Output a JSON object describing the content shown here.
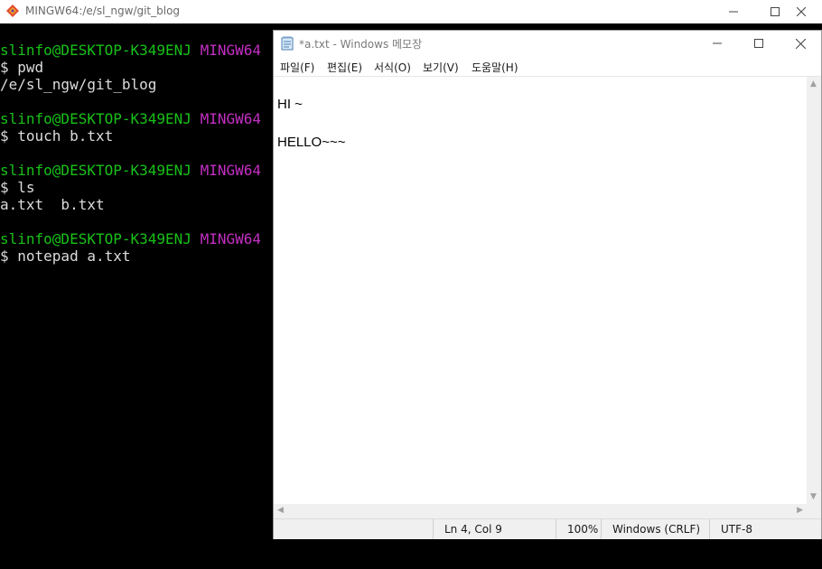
{
  "terminal": {
    "title": "MINGW64:/e/sl_ngw/git_blog",
    "lines": [
      {
        "user": "slinfo@DESKTOP-K349ENJ",
        "env": "MINGW64"
      },
      "$ pwd",
      "/e/sl_ngw/git_blog",
      {
        "user": "slinfo@DESKTOP-K349ENJ",
        "env": "MINGW64"
      },
      "$ touch b.txt",
      {
        "user": "slinfo@DESKTOP-K349ENJ",
        "env": "MINGW64"
      },
      "$ ls",
      "a.txt  b.txt",
      {
        "user": "slinfo@DESKTOP-K349ENJ",
        "env": "MINGW64"
      },
      "$ notepad a.txt"
    ],
    "prompt_user": "slinfo@DESKTOP-K349ENJ",
    "prompt_env": "MINGW64",
    "cmd_pwd": "$ pwd",
    "out_pwd": "/e/sl_ngw/git_blog",
    "cmd_touch": "$ touch b.txt",
    "cmd_ls": "$ ls",
    "out_ls": "a.txt  b.txt",
    "cmd_notepad": "$ notepad a.txt",
    "colors": {
      "user": "#18c218",
      "env": "#c22fc2",
      "text": "#dcdcdc",
      "bg": "#000000"
    }
  },
  "notepad": {
    "title": "*a.txt - Windows 메모장",
    "menu": {
      "file": "파일(F)",
      "edit": "편집(E)",
      "format": "서식(O)",
      "view": "보기(V)",
      "help": "도움말(H)"
    },
    "content": {
      "line1": "HI ~",
      "line2": "",
      "line3": "HELLO~~~"
    },
    "status": {
      "position": "Ln 4, Col 9",
      "zoom": "100%",
      "line_ending": "Windows (CRLF)",
      "encoding": "UTF-8"
    }
  },
  "window_controls": {
    "minimize": "—",
    "maximize": "☐",
    "close": "✕"
  }
}
